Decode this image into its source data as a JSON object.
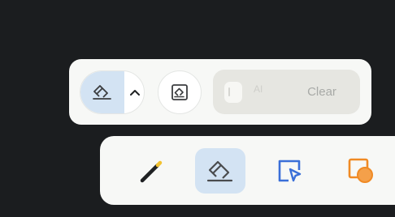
{
  "eraser_popup": {
    "mode_current_icon": "eraser-icon",
    "mode_chevron_icon": "chevron-up-icon",
    "mode_alt_icon": "area-eraser-icon",
    "clear_toggle": {
      "dim_label": "AI",
      "label": "Clear"
    }
  },
  "toolbar": {
    "tools": [
      {
        "name": "pen",
        "icon": "pen-icon",
        "selected": false
      },
      {
        "name": "eraser",
        "icon": "eraser-icon",
        "selected": true
      },
      {
        "name": "select",
        "icon": "selection-icon",
        "selected": false
      },
      {
        "name": "shapes",
        "icon": "shapes-icon",
        "selected": false
      }
    ]
  },
  "colors": {
    "background": "#1b1d1f",
    "panel": "#f7f8f6",
    "selected": "#d3e3f3",
    "icon_dark": "#3b3d3f",
    "accent_blue": "#3a6fd8",
    "accent_orange": "#f08a24",
    "pen_tip": "#f2c230"
  }
}
